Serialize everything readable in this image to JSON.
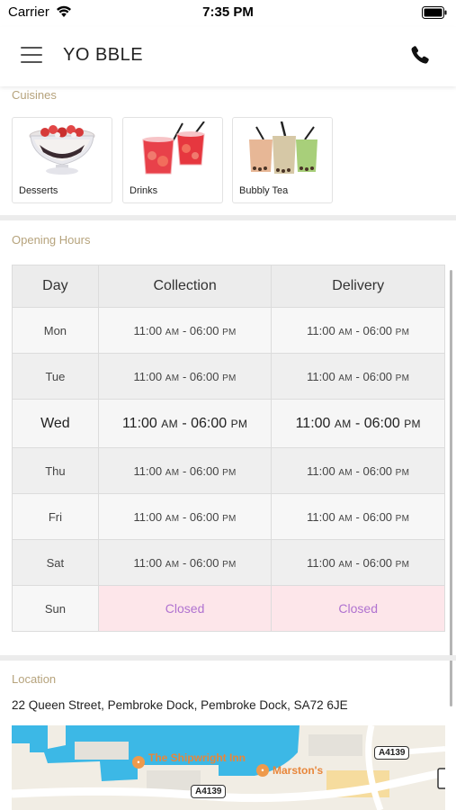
{
  "status_bar": {
    "carrier": "Carrier",
    "time": "7:35 PM"
  },
  "header": {
    "title": "YO BBLE",
    "icons": [
      "menu-icon",
      "phone-icon"
    ]
  },
  "cuisines": {
    "label": "Cuisines",
    "items": [
      {
        "name": "Desserts"
      },
      {
        "name": "Drinks"
      },
      {
        "name": "Bubbly Tea"
      }
    ]
  },
  "opening_hours": {
    "label": "Opening Hours",
    "columns": [
      "Day",
      "Collection",
      "Delivery"
    ],
    "rows": [
      {
        "day": "Mon",
        "collection_open": "11:00",
        "collection_close": "06:00",
        "delivery_open": "11:00",
        "delivery_close": "06:00"
      },
      {
        "day": "Tue",
        "collection_open": "11:00",
        "collection_close": "06:00",
        "delivery_open": "11:00",
        "delivery_close": "06:00"
      },
      {
        "day": "Wed",
        "collection_open": "11:00",
        "collection_close": "06:00",
        "delivery_open": "11:00",
        "delivery_close": "06:00"
      },
      {
        "day": "Thu",
        "collection_open": "11:00",
        "collection_close": "06:00",
        "delivery_open": "11:00",
        "delivery_close": "06:00"
      },
      {
        "day": "Fri",
        "collection_open": "11:00",
        "collection_close": "06:00",
        "delivery_open": "11:00",
        "delivery_close": "06:00"
      },
      {
        "day": "Sat",
        "collection_open": "11:00",
        "collection_close": "06:00",
        "delivery_open": "11:00",
        "delivery_close": "06:00"
      },
      {
        "day": "Sun",
        "collection": "Closed",
        "delivery": "Closed"
      }
    ],
    "am": "AM",
    "pm": "PM",
    "dash": " - "
  },
  "location": {
    "label": "Location",
    "address": "22 Queen Street, Pembroke Dock, Pembroke Dock, SA72 6JE",
    "map": {
      "places": [
        "The Shipwright Inn",
        "Marston's"
      ],
      "roads": [
        "A4139",
        "A4139"
      ]
    }
  },
  "colors": {
    "section_label": "#b6a37c",
    "closed_text": "#b072d0",
    "closed_bg": "#fde6ea",
    "water": "#3cb8e6",
    "poi": "#e8863a"
  }
}
